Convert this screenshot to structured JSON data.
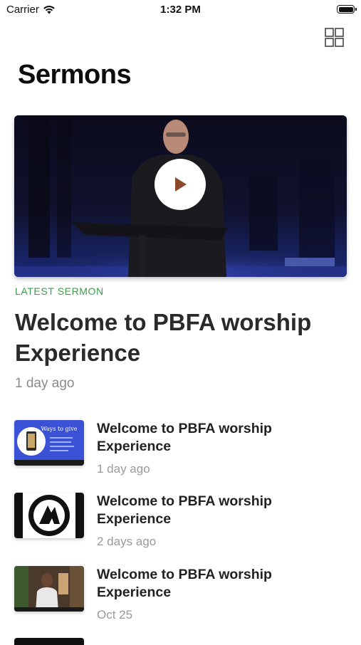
{
  "status_bar": {
    "carrier": "Carrier",
    "time": "1:32 PM"
  },
  "header": {
    "title": "Sermons",
    "layout_toggle_icon": "grid-icon"
  },
  "latest": {
    "label": "LATEST SERMON",
    "title": "Welcome to PBFA worship Experience",
    "date": "1 day ago",
    "play_icon": "play-icon"
  },
  "sermons": [
    {
      "title": "Welcome to PBFA worship Experience",
      "date": "1 day ago",
      "thumb_text": "Ways to give"
    },
    {
      "title": "Welcome to PBFA worship Experience",
      "date": "2 days ago"
    },
    {
      "title": "Welcome to PBFA worship Experience",
      "date": "Oct 25"
    }
  ],
  "colors": {
    "accent_green": "#3a9b4b",
    "play_triangle": "#8b4a2b",
    "thumb_blue": "#3b51d6"
  }
}
